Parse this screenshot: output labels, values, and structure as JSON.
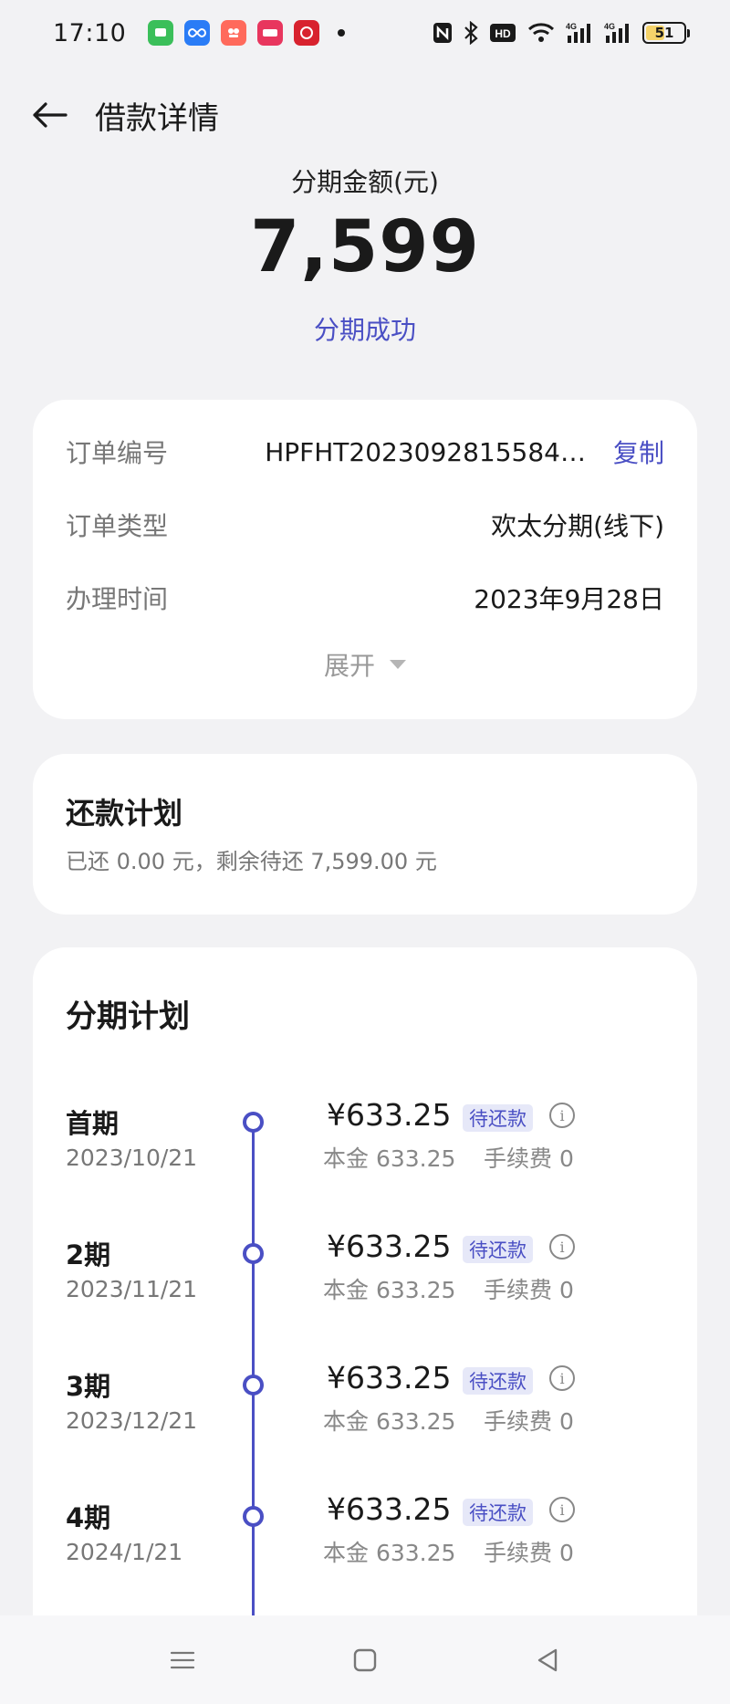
{
  "status_bar": {
    "time": "17:10",
    "battery": "51",
    "hd_label": "HD",
    "net_labels": [
      "4G",
      "4G"
    ],
    "notif_icons": [
      {
        "name": "messages-icon",
        "color": "#3bbf5a"
      },
      {
        "name": "infinity-app-icon",
        "color": "#2a7cf6"
      },
      {
        "name": "camera-app-icon",
        "color": "#ff6a5c"
      },
      {
        "name": "search-app-icon",
        "color": "#e8365e"
      },
      {
        "name": "shopping-app-icon",
        "color": "#d8222e"
      }
    ]
  },
  "header": {
    "title": "借款详情"
  },
  "summary": {
    "amount_label": "分期金额(元)",
    "amount": "7,599",
    "status": "分期成功"
  },
  "order": {
    "rows": [
      {
        "label": "订单编号",
        "value": "HPFHT2023092815584…"
      },
      {
        "label": "订单类型",
        "value": "欢太分期(线下)"
      },
      {
        "label": "办理时间",
        "value": "2023年9月28日"
      }
    ],
    "copy_label": "复制",
    "expand_label": "展开"
  },
  "repayment_plan": {
    "title": "还款计划",
    "subtitle": "已还 0.00 元，剩余待还 7,599.00 元"
  },
  "schedule": {
    "title": "分期计划",
    "installments": [
      {
        "name": "首期",
        "date": "2023/10/21",
        "amount": "¥633.25",
        "tag": "待还款",
        "principal": "本金 633.25",
        "fee": "手续费 0"
      },
      {
        "name": "2期",
        "date": "2023/11/21",
        "amount": "¥633.25",
        "tag": "待还款",
        "principal": "本金 633.25",
        "fee": "手续费 0"
      },
      {
        "name": "3期",
        "date": "2023/12/21",
        "amount": "¥633.25",
        "tag": "待还款",
        "principal": "本金 633.25",
        "fee": "手续费 0"
      },
      {
        "name": "4期",
        "date": "2024/1/21",
        "amount": "¥633.25",
        "tag": "待还款",
        "principal": "本金 633.25",
        "fee": "手续费 0"
      }
    ]
  },
  "colors": {
    "accent": "#4a4fc4",
    "tag_bg": "#e6e8f8"
  }
}
